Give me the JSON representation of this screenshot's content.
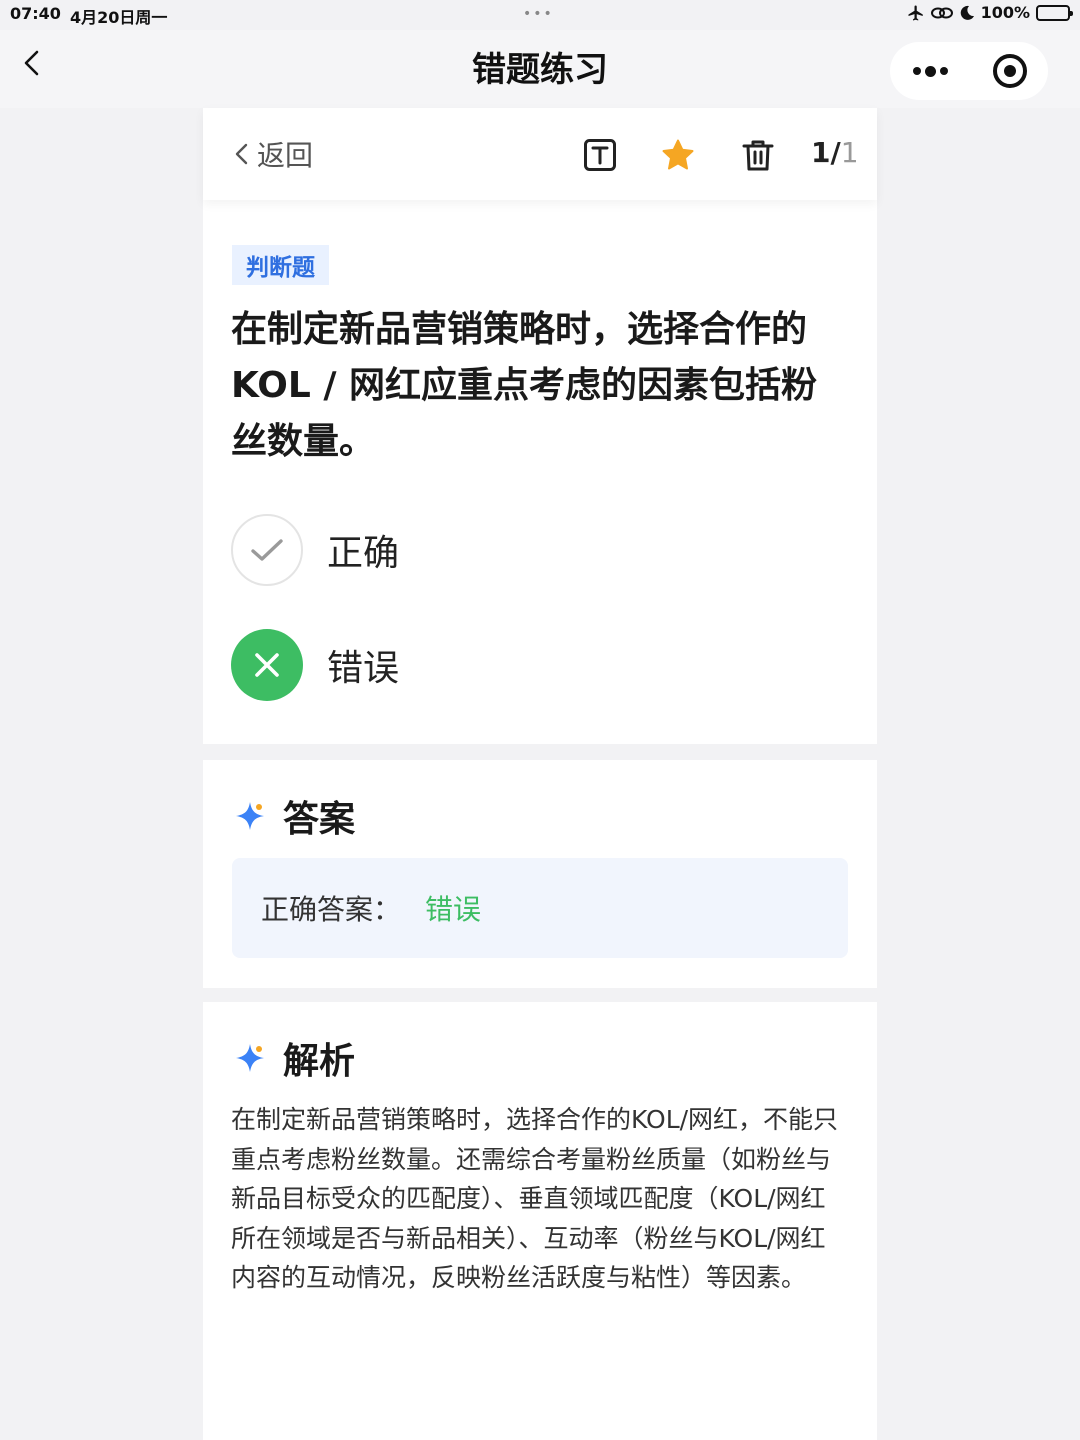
{
  "status_bar": {
    "time": "07:40",
    "date": "4月20日周一",
    "battery": "100%"
  },
  "nav": {
    "title": "错题练习"
  },
  "toolbar": {
    "back_label": "返回",
    "count_current": "1/",
    "count_total": "1"
  },
  "question": {
    "type_tag": "判断题",
    "text": "在制定新品营销策略时，选择合作的 KOL / 网红应重点考虑的因素包括粉丝数量。",
    "options": [
      {
        "label": "正确",
        "state": "unselected"
      },
      {
        "label": "错误",
        "state": "selected-wrong"
      }
    ]
  },
  "answer": {
    "title": "答案",
    "prefix": "正确答案：",
    "value": "错误"
  },
  "analysis": {
    "title": "解析",
    "text": "在制定新品营销策略时，选择合作的KOL/网红，不能只重点考虑粉丝数量。还需综合考量粉丝质量（如粉丝与新品目标受众的匹配度）、垂直领域匹配度（KOL/网红所在领域是否与新品相关）、互动率（粉丝与KOL/网红内容的互动情况，反映粉丝活跃度与粘性）等因素。"
  },
  "colors": {
    "accent_blue": "#2f6fe0",
    "correct_green": "#3dbd63",
    "star_orange": "#f5a623"
  },
  "icons": [
    "back-chevron-icon",
    "text-mode-icon",
    "star-icon",
    "trash-icon",
    "more-icon",
    "target-icon",
    "check-icon",
    "close-icon",
    "sparkle-icon"
  ]
}
